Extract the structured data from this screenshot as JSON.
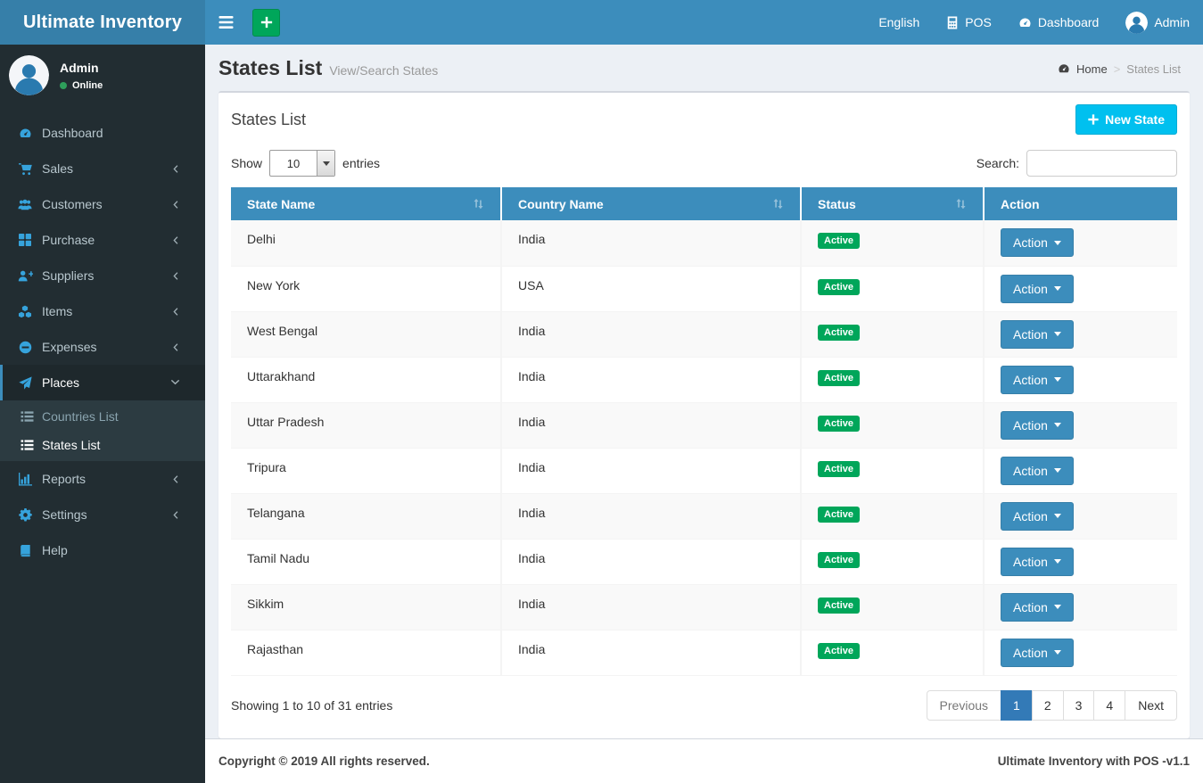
{
  "brand": "Ultimate Inventory",
  "navbar": {
    "items": [
      {
        "label": "English",
        "icon": null
      },
      {
        "label": "POS",
        "icon": "calculator-icon"
      },
      {
        "label": "Dashboard",
        "icon": "dashboard-icon"
      },
      {
        "label": "Admin",
        "icon": "person-icon",
        "avatar": true
      }
    ]
  },
  "sidebar": {
    "user": {
      "name": "Admin",
      "status": "Online"
    },
    "items": [
      {
        "label": "Dashboard",
        "icon": "dashboard-icon",
        "chevron": null
      },
      {
        "label": "Sales",
        "icon": "cart-icon",
        "chevron": "left"
      },
      {
        "label": "Customers",
        "icon": "users-icon",
        "chevron": "left"
      },
      {
        "label": "Purchase",
        "icon": "grid-icon",
        "chevron": "left"
      },
      {
        "label": "Suppliers",
        "icon": "user-plus-icon",
        "chevron": "left"
      },
      {
        "label": "Items",
        "icon": "cubes-icon",
        "chevron": "left"
      },
      {
        "label": "Expenses",
        "icon": "minus-circle-icon",
        "chevron": "left"
      },
      {
        "label": "Places",
        "icon": "paper-plane-icon",
        "chevron": "down",
        "active": true,
        "children": [
          {
            "label": "Countries List",
            "icon": "list-icon",
            "active": false
          },
          {
            "label": "States List",
            "icon": "list-icon",
            "active": true
          }
        ]
      },
      {
        "label": "Reports",
        "icon": "bar-chart-icon",
        "chevron": "left"
      },
      {
        "label": "Settings",
        "icon": "gears-icon",
        "chevron": "left"
      },
      {
        "label": "Help",
        "icon": "book-icon",
        "chevron": null
      }
    ]
  },
  "page": {
    "title": "States List",
    "subtitle": "View/Search States",
    "breadcrumb_home": "Home",
    "breadcrumb_sep": ">",
    "breadcrumb_current": "States List"
  },
  "card": {
    "title": "States List",
    "new_button_label": "New State",
    "plus_glyph": "+"
  },
  "toolbar": {
    "show_label": "Show",
    "page_length": "10",
    "entries_label": "entries",
    "search_label": "Search:",
    "search_value": ""
  },
  "table": {
    "columns": [
      {
        "label": "State Name",
        "sortable": true
      },
      {
        "label": "Country Name",
        "sortable": true
      },
      {
        "label": "Status",
        "sortable": true
      },
      {
        "label": "Action",
        "sortable": false
      }
    ],
    "rows": [
      {
        "state": "Delhi",
        "country": "India",
        "status": "Active",
        "action": "Action"
      },
      {
        "state": "New York",
        "country": "USA",
        "status": "Active",
        "action": "Action"
      },
      {
        "state": "West Bengal",
        "country": "India",
        "status": "Active",
        "action": "Action"
      },
      {
        "state": "Uttarakhand",
        "country": "India",
        "status": "Active",
        "action": "Action"
      },
      {
        "state": "Uttar Pradesh",
        "country": "India",
        "status": "Active",
        "action": "Action"
      },
      {
        "state": "Tripura",
        "country": "India",
        "status": "Active",
        "action": "Action"
      },
      {
        "state": "Telangana",
        "country": "India",
        "status": "Active",
        "action": "Action"
      },
      {
        "state": "Tamil Nadu",
        "country": "India",
        "status": "Active",
        "action": "Action"
      },
      {
        "state": "Sikkim",
        "country": "India",
        "status": "Active",
        "action": "Action"
      },
      {
        "state": "Rajasthan",
        "country": "India",
        "status": "Active",
        "action": "Action"
      }
    ]
  },
  "table_footer": {
    "info": "Showing 1 to 10 of 31 entries",
    "pagination": {
      "prev": "Previous",
      "pages": [
        "1",
        "2",
        "3",
        "4"
      ],
      "active_page": "1",
      "next": "Next"
    }
  },
  "footer": {
    "left": "Copyright © 2019 All rights reserved.",
    "right": "Ultimate Inventory with POS -v1.1"
  },
  "colors": {
    "navbar": "#3c8dbc",
    "logo_bg": "#367fa9",
    "sidebar_bg": "#222d32",
    "submenu_bg": "#2c3b41",
    "green": "#00a65a",
    "new_button_cyan": "#00c0ef",
    "pagination_active": "#337ab7",
    "sidebar_icon_blue": "#36a3dc",
    "content_bg": "#ecf0f5"
  }
}
